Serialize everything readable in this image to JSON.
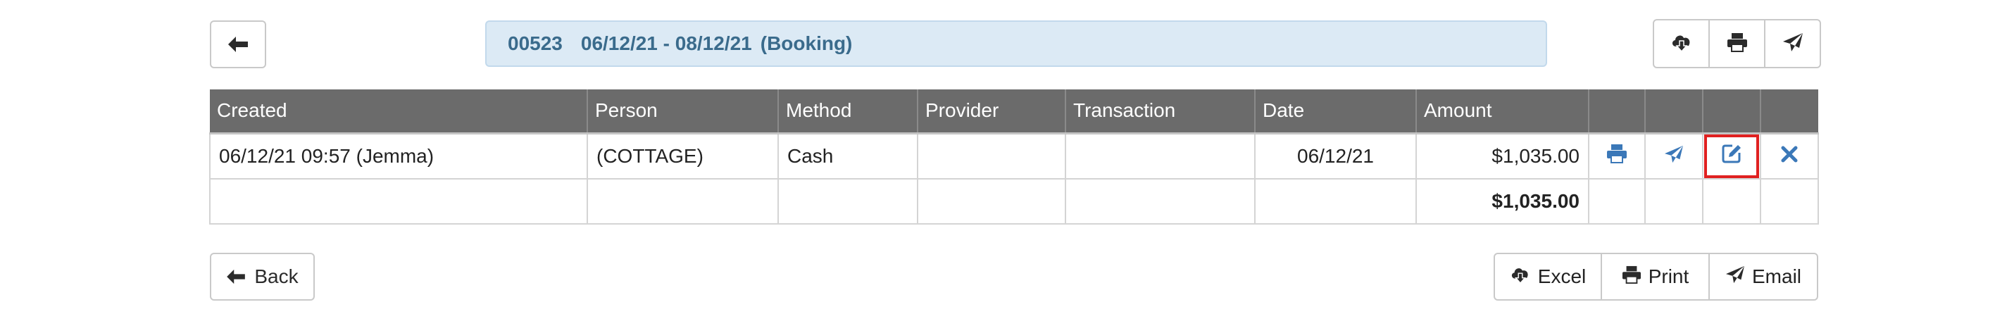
{
  "header": {
    "booking_id": "00523",
    "date_range": "06/12/21 - 08/12/21",
    "booking_type": "(Booking)"
  },
  "table": {
    "columns": [
      "Created",
      "Person",
      "Method",
      "Provider",
      "Transaction",
      "Date",
      "Amount"
    ],
    "rows": [
      {
        "created": "06/12/21 09:57 (Jemma)",
        "person": "(COTTAGE)",
        "method": "Cash",
        "provider": "",
        "transaction": "",
        "date": "06/12/21",
        "amount": "$1,035.00"
      }
    ],
    "total": "$1,035.00"
  },
  "footer": {
    "back_label": "Back",
    "excel_label": "Excel",
    "print_label": "Print",
    "email_label": "Email"
  },
  "icons": {
    "back": "arrow-left-icon",
    "download": "cloud-download-icon",
    "print": "printer-icon",
    "send": "paper-plane-icon",
    "edit": "edit-icon",
    "delete": "close-icon"
  },
  "colors": {
    "header_bg": "#6b6b6b",
    "title_bg": "#dceaf5",
    "title_text": "#3a6b8c",
    "action_icon": "#3b78b8",
    "highlight": "#e02020"
  }
}
